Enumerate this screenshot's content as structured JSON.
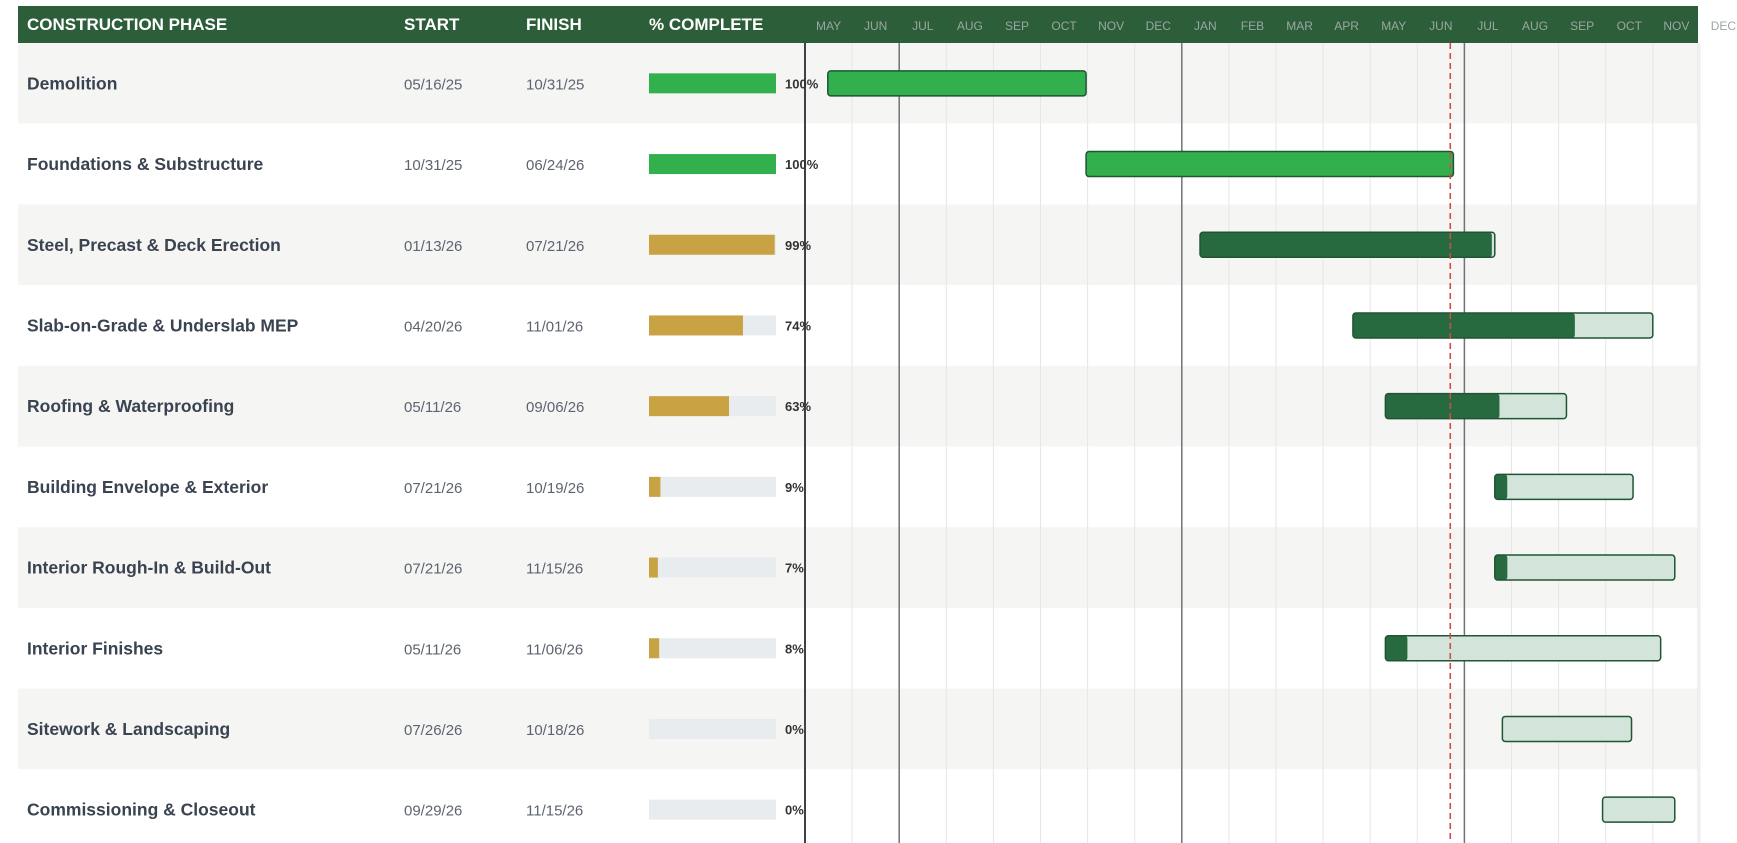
{
  "chart_data": {
    "type": "gantt",
    "columns": {
      "phase": "CONSTRUCTION PHASE",
      "start": "START",
      "finish": "FINISH",
      "complete": "% COMPLETE"
    },
    "timeline": {
      "start": "2025-05-01",
      "end": "2026-12-31",
      "month_labels": [
        "MAY",
        "JUN",
        "JUL",
        "AUG",
        "SEP",
        "OCT",
        "NOV",
        "DEC",
        "JAN",
        "FEB",
        "MAR",
        "APR",
        "MAY",
        "JUN",
        "JUL",
        "AUG",
        "SEP",
        "OCT",
        "NOV",
        "DEC"
      ],
      "today": "2026-06-22"
    },
    "tasks": [
      {
        "phase": "Demolition",
        "start": "05/16/25",
        "finish": "10/31/25",
        "percent": 100,
        "percent_label": "100%"
      },
      {
        "phase": "Foundations & Substructure",
        "start": "10/31/25",
        "finish": "06/24/26",
        "percent": 100,
        "percent_label": "100%"
      },
      {
        "phase": "Steel, Precast & Deck Erection",
        "start": "01/13/26",
        "finish": "07/21/26",
        "percent": 99,
        "percent_label": "99%"
      },
      {
        "phase": "Slab-on-Grade & Underslab MEP",
        "start": "04/20/26",
        "finish": "11/01/26",
        "percent": 74,
        "percent_label": "74%"
      },
      {
        "phase": "Roofing & Waterproofing",
        "start": "05/11/26",
        "finish": "09/06/26",
        "percent": 63,
        "percent_label": "63%"
      },
      {
        "phase": "Building Envelope & Exterior",
        "start": "07/21/26",
        "finish": "10/19/26",
        "percent": 9,
        "percent_label": "9%"
      },
      {
        "phase": "Interior Rough-In & Build-Out",
        "start": "07/21/26",
        "finish": "11/15/26",
        "percent": 7,
        "percent_label": "7%"
      },
      {
        "phase": "Interior Finishes",
        "start": "05/11/26",
        "finish": "11/06/26",
        "percent": 8,
        "percent_label": "8%"
      },
      {
        "phase": "Sitework & Landscaping",
        "start": "07/26/26",
        "finish": "10/18/26",
        "percent": 0,
        "percent_label": "0%"
      },
      {
        "phase": "Commissioning & Closeout",
        "start": "09/29/26",
        "finish": "11/15/26",
        "percent": 0,
        "percent_label": "0%"
      }
    ],
    "colors": {
      "header_bg": "#2d5e3a",
      "row_alt": "#f5f5f4",
      "row_plain": "#ffffff",
      "progress_done": "#33b04e",
      "progress_partial": "#c9a244",
      "progress_track": "#e8ecee",
      "bar_complete": "#33b04e",
      "bar_done": "#286a3f",
      "bar_remaining": "#d3e5da",
      "bar_outline": "#1f5533",
      "today_line": "#d24b4b",
      "grid_light": "#e6e6e6",
      "grid_year": "#6f7377"
    }
  }
}
